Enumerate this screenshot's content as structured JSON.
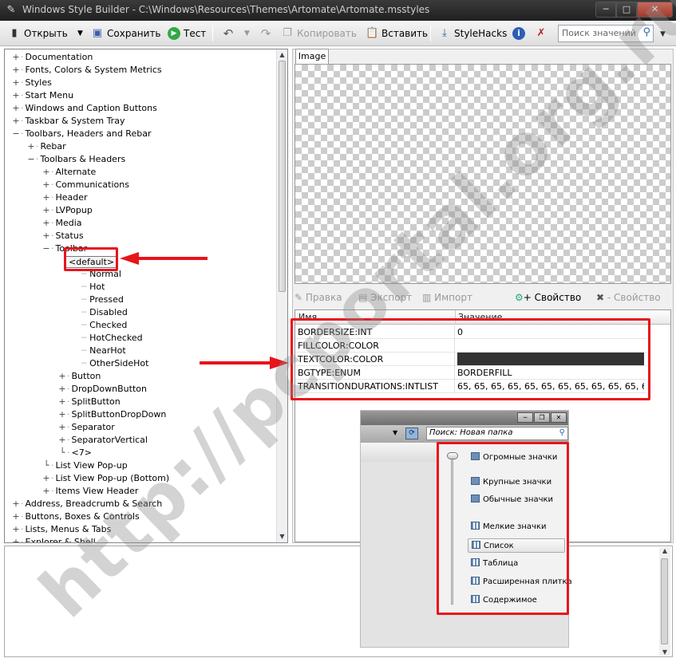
{
  "window": {
    "title": "Windows Style Builder - C:\\Windows\\Resources\\Themes\\Artomate\\Artomate.msstyles",
    "minimize": "─",
    "maximize": "□",
    "close": "✕"
  },
  "toolbar": {
    "open": "Открыть",
    "save": "Сохранить",
    "test": "Тест",
    "copy": "Копировать",
    "paste": "Вставить",
    "stylehacks": "StyleHacks",
    "search_placeholder": "Поиск значений"
  },
  "tree": [
    {
      "label": "Documentation",
      "exp": "+",
      "level": 0
    },
    {
      "label": "Fonts, Colors & System Metrics",
      "exp": "+",
      "level": 0
    },
    {
      "label": "Styles",
      "exp": "+",
      "level": 0
    },
    {
      "label": "Start Menu",
      "exp": "+",
      "level": 0
    },
    {
      "label": "Windows and Caption Buttons",
      "exp": "+",
      "level": 0
    },
    {
      "label": "Taskbar & System Tray",
      "exp": "+",
      "level": 0
    },
    {
      "label": "Toolbars, Headers and Rebar",
      "exp": "−",
      "level": 0
    },
    {
      "label": "Rebar",
      "exp": "+",
      "level": 1
    },
    {
      "label": "Toolbars & Headers",
      "exp": "−",
      "level": 1
    },
    {
      "label": "Alternate",
      "exp": "+",
      "level": 2
    },
    {
      "label": "Communications",
      "exp": "+",
      "level": 2
    },
    {
      "label": "Header",
      "exp": "+",
      "level": 2
    },
    {
      "label": "LVPopup",
      "exp": "+",
      "level": 2
    },
    {
      "label": "Media",
      "exp": "+",
      "level": 2
    },
    {
      "label": "Status",
      "exp": "+",
      "level": 2
    },
    {
      "label": "Toolbar",
      "exp": "−",
      "level": 2
    },
    {
      "label": "<default>",
      "exp": "",
      "level": 3,
      "boxed": true
    },
    {
      "label": "Normal",
      "exp": "",
      "level": 4
    },
    {
      "label": "Hot",
      "exp": "",
      "level": 4
    },
    {
      "label": "Pressed",
      "exp": "",
      "level": 4
    },
    {
      "label": "Disabled",
      "exp": "",
      "level": 4
    },
    {
      "label": "Checked",
      "exp": "",
      "level": 4
    },
    {
      "label": "HotChecked",
      "exp": "",
      "level": 4
    },
    {
      "label": "NearHot",
      "exp": "",
      "level": 4
    },
    {
      "label": "OtherSideHot",
      "exp": "",
      "level": 4
    },
    {
      "label": "Button",
      "exp": "+",
      "level": 3
    },
    {
      "label": "DropDownButton",
      "exp": "+",
      "level": 3
    },
    {
      "label": "SplitButton",
      "exp": "+",
      "level": 3
    },
    {
      "label": "SplitButtonDropDown",
      "exp": "+",
      "level": 3
    },
    {
      "label": "Separator",
      "exp": "+",
      "level": 3
    },
    {
      "label": "SeparatorVertical",
      "exp": "+",
      "level": 3
    },
    {
      "label": "<7>",
      "exp": "",
      "level": 3
    },
    {
      "label": "List View Pop-up",
      "exp": "",
      "level": 2
    },
    {
      "label": "List View Pop-up (Bottom)",
      "exp": "+",
      "level": 2
    },
    {
      "label": "Items View Header",
      "exp": "+",
      "level": 2
    },
    {
      "label": "Address, Breadcrumb & Search",
      "exp": "+",
      "level": 0
    },
    {
      "label": "Buttons, Boxes & Controls",
      "exp": "+",
      "level": 0
    },
    {
      "label": "Lists, Menus & Tabs",
      "exp": "+",
      "level": 0
    },
    {
      "label": "Explorer & Shell",
      "exp": "+",
      "level": 0
    }
  ],
  "right": {
    "tab_image": "Image",
    "edit": "Правка",
    "export": "Экспорт",
    "import": "Импорт",
    "add_property": "+ Свойство",
    "remove_property": "- Свойство",
    "col_name": "Имя",
    "col_value": "Значение"
  },
  "properties": [
    {
      "name": "BORDERSIZE:INT",
      "value": "0"
    },
    {
      "name": "FILLCOLOR:COLOR",
      "value": ""
    },
    {
      "name": "TEXTCOLOR:COLOR",
      "value": "",
      "swatch": "#333333"
    },
    {
      "name": "BGTYPE:ENUM",
      "value": "BORDERFILL"
    },
    {
      "name": "TRANSITIONDURATIONS:INTLIST",
      "value": "65, 65, 65, 65, 65, 65, 65, 65, 65, 65, 65, 65..."
    }
  ],
  "inset": {
    "search": "Поиск: Новая папка",
    "menu": [
      {
        "label": "Огромные значки"
      },
      {
        "label": "Крупные значки"
      },
      {
        "label": "Обычные значки"
      },
      {
        "label": "Мелкие значки"
      },
      {
        "label": "Список",
        "selected": true
      },
      {
        "label": "Таблица"
      },
      {
        "label": "Расширенная плитка"
      },
      {
        "label": "Содержимое"
      }
    ]
  },
  "watermark": "http://pcportal.org.ru",
  "colors": {
    "annotation_red": "#e8141c",
    "title_bar": "#2b2b2b"
  }
}
